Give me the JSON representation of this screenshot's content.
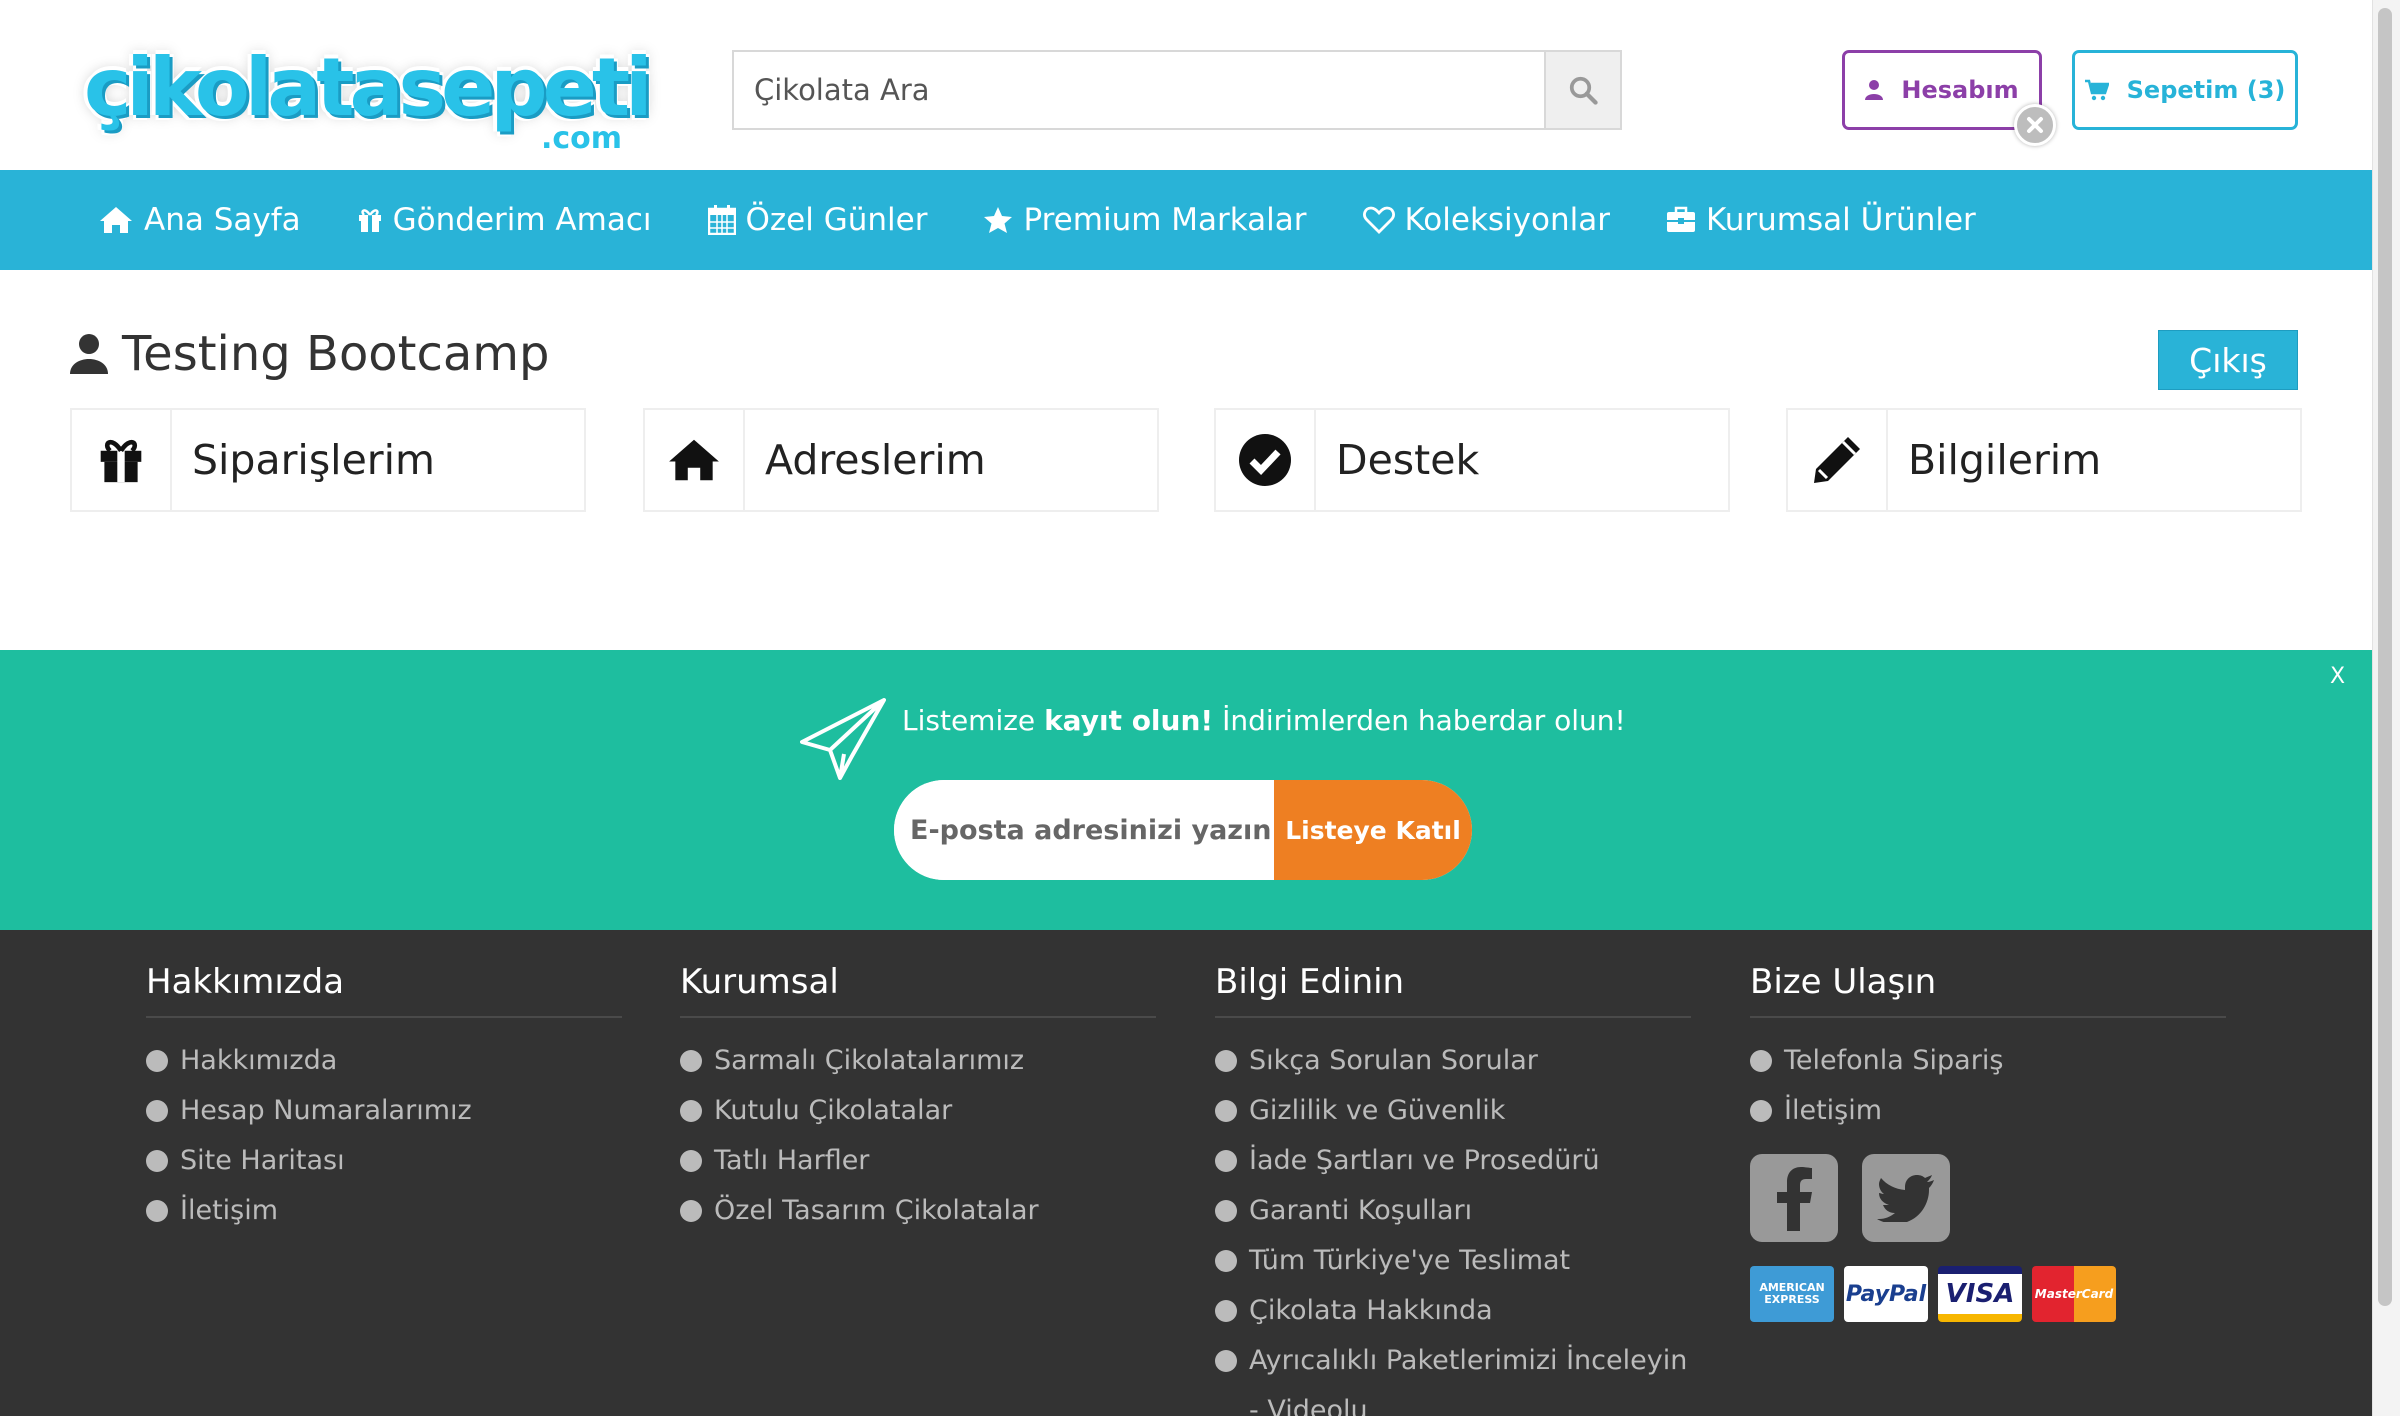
{
  "header": {
    "logo_text": "çikolatasepeti",
    "logo_suffix": ".com",
    "search_placeholder": "Çikolata Ara",
    "account_label": "Hesabım",
    "cart_label": "Sepetim (3)"
  },
  "nav": {
    "items": [
      {
        "label": "Ana Sayfa",
        "icon": "home-icon"
      },
      {
        "label": "Gönderim Amacı",
        "icon": "gift-icon"
      },
      {
        "label": "Özel Günler",
        "icon": "calendar-icon"
      },
      {
        "label": "Premium Markalar",
        "icon": "star-icon"
      },
      {
        "label": "Koleksiyonlar",
        "icon": "heart-icon"
      },
      {
        "label": "Kurumsal Ürünler",
        "icon": "briefcase-icon"
      }
    ]
  },
  "account": {
    "user_name": "Testing Bootcamp",
    "logout_label": "Çıkış",
    "cards": [
      {
        "label": "Siparişlerim",
        "icon": "gift-icon"
      },
      {
        "label": "Adreslerim",
        "icon": "home-icon"
      },
      {
        "label": "Destek",
        "icon": "check-circle-icon"
      },
      {
        "label": "Bilgilerim",
        "icon": "pencil-icon"
      }
    ]
  },
  "newsletter": {
    "text_prefix": "Listemize ",
    "text_bold": "kayıt olun!",
    "text_suffix": " İndirimlerden haberdar olun!",
    "email_placeholder": "E-posta adresinizi yazın",
    "button_label": "Listeye Katıl",
    "close_label": "X"
  },
  "footer": {
    "columns": [
      {
        "title": "Hakkımızda",
        "links": [
          "Hakkımızda",
          "Hesap Numaralarımız",
          "Site Haritası",
          "İletişim"
        ]
      },
      {
        "title": "Kurumsal",
        "links": [
          "Sarmalı Çikolatalarımız",
          "Kutulu Çikolatalar",
          "Tatlı Harfler",
          "Özel Tasarım Çikolatalar"
        ]
      },
      {
        "title": "Bilgi Edinin",
        "links": [
          "Sıkça Sorulan Sorular",
          "Gizlilik ve Güvenlik",
          "İade Şartları ve Prosedürü",
          "Garanti Koşulları",
          "Tüm Türkiye'ye Teslimat",
          "Çikolata Hakkında",
          "Ayrıcalıklı Paketlerimizi İnceleyin - Videolu"
        ]
      },
      {
        "title": "Bize Ulaşın",
        "links": [
          "Telefonla Sipariş",
          "İletişim"
        ]
      }
    ],
    "social": [
      "facebook-icon",
      "twitter-icon"
    ],
    "payments": [
      {
        "label": "AMERICAN EXPRESS"
      },
      {
        "label": "PayPal"
      },
      {
        "label": "VISA"
      },
      {
        "label": "MasterCard"
      }
    ]
  },
  "colors": {
    "brand_blue": "#29b3d7",
    "account_purple": "#8c3fa8",
    "newsletter_green": "#1ebe9f",
    "cta_orange": "#ee7f22",
    "footer_bg": "#333333"
  }
}
